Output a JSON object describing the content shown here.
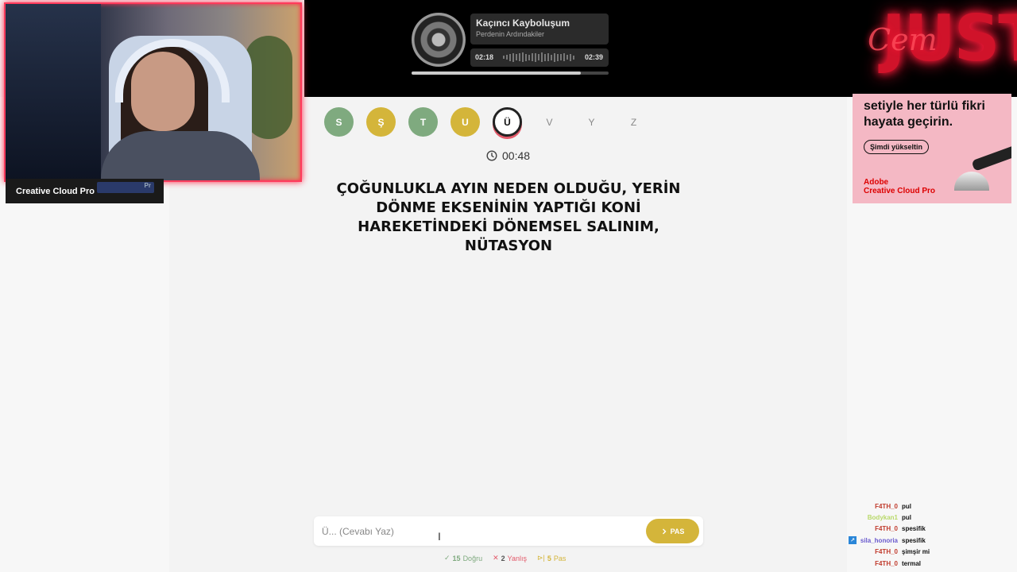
{
  "music": {
    "title": "Kaçıncı Kayboluşum",
    "artist": "Perdenin Ardındakiler",
    "current_time": "02:18",
    "total_time": "02:39",
    "progress": 0.86
  },
  "brand": {
    "neon_text": "JUST",
    "neon_script": "Cem"
  },
  "ad_left": {
    "text": "Creative Cloud Pro",
    "badge": "Pr"
  },
  "ad_right": {
    "headline": "setiyle her türlü fikri hayata geçirin.",
    "button": "Şimdi yükseltin",
    "brand_line1": "Adobe",
    "brand_line2": "Creative Cloud Pro"
  },
  "game": {
    "letters": [
      {
        "char": "S",
        "state": "correct"
      },
      {
        "char": "Ş",
        "state": "passed"
      },
      {
        "char": "T",
        "state": "correct"
      },
      {
        "char": "U",
        "state": "passed"
      },
      {
        "char": "Ü",
        "state": "current"
      },
      {
        "char": "V",
        "state": "pending"
      },
      {
        "char": "Y",
        "state": "pending"
      },
      {
        "char": "Z",
        "state": "pending"
      }
    ],
    "timer": "00:48",
    "question": "ÇOĞUNLUKLA AYIN NEDEN OLDUĞU, YERİN DÖNME EKSENİNİN YAPTIĞI KONİ HAREKETİNDEKİ DÖNEMSEL SALINIM, NÜTASYON",
    "answer_placeholder": "Ü... (Cevabı Yaz)",
    "pass_label": "PAS",
    "stats": {
      "correct_count": "15",
      "correct_label": "Doğru",
      "wrong_count": "2",
      "wrong_label": "Yanlış",
      "pass_count": "5",
      "pass_label": "Pas"
    }
  },
  "chat": [
    {
      "user": "F4TH_0",
      "message": "pul",
      "color": "#c0392b",
      "badge": false
    },
    {
      "user": "Bodykan1",
      "message": "pul",
      "color": "#b9d96a",
      "badge": false
    },
    {
      "user": "F4TH_0",
      "message": "spesifik",
      "color": "#c0392b",
      "badge": false
    },
    {
      "user": "sila_honoria",
      "message": "spesifik",
      "color": "#6a5acd",
      "badge": true
    },
    {
      "user": "F4TH_0",
      "message": "şimşir mi",
      "color": "#c0392b",
      "badge": false
    },
    {
      "user": "F4TH_0",
      "message": "termal",
      "color": "#c0392b",
      "badge": false
    }
  ],
  "colors": {
    "correct": "#7faa7f",
    "passed": "#d4b53a",
    "current_border": "#222222",
    "wrong": "#e35a6a"
  }
}
